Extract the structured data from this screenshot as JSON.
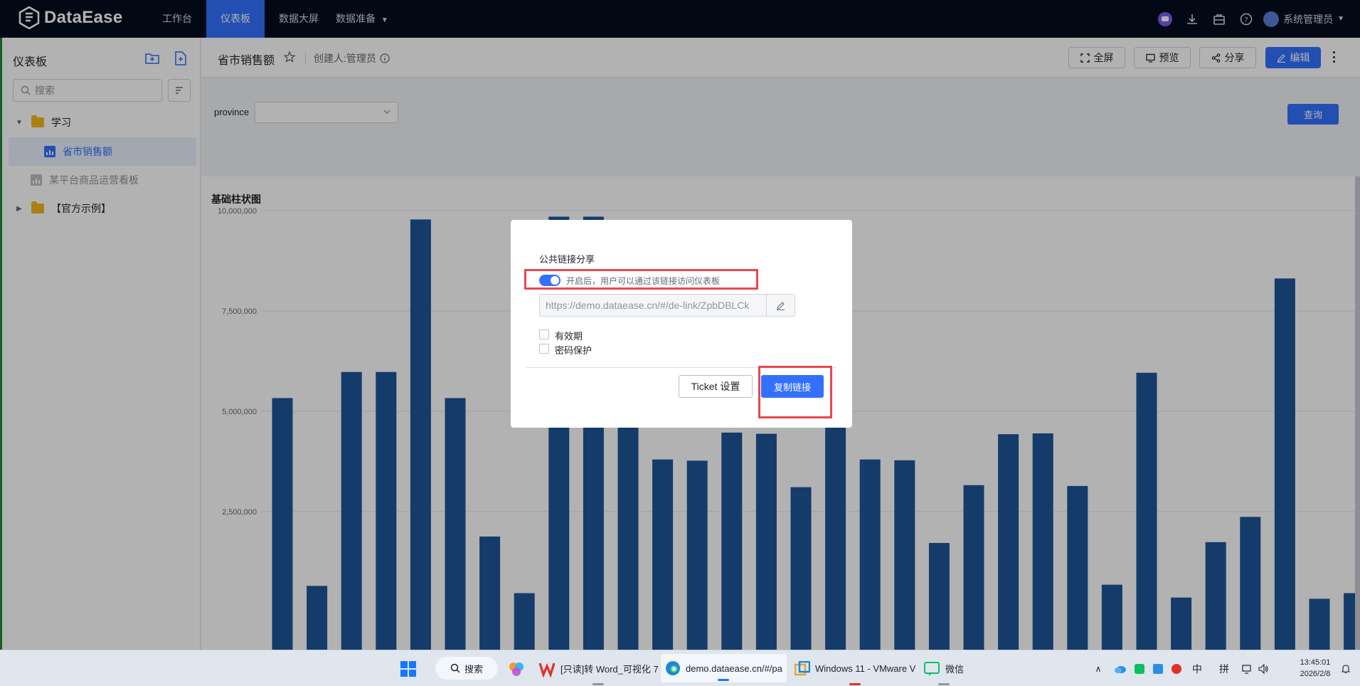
{
  "app": {
    "logo_text": "DataEase",
    "nav": [
      "工作台",
      "仪表板",
      "数据大屏",
      "数据准备"
    ],
    "user_name": "系统管理员"
  },
  "sidebar": {
    "title": "仪表板",
    "search_placeholder": "搜索",
    "tree": [
      {
        "label": "学习",
        "type": "folder"
      },
      {
        "label": "省市销售额",
        "type": "dashboard",
        "selected": true
      },
      {
        "label": "某平台商品运营看板",
        "type": "dashboard"
      },
      {
        "label": "【官方示例】",
        "type": "folder"
      }
    ]
  },
  "header": {
    "title": "省市销售额",
    "creator": "创建人:管理员",
    "buttons": {
      "fullscreen": "全屏",
      "preview": "预览",
      "share": "分享",
      "edit": "编辑"
    }
  },
  "filter": {
    "label": "province",
    "value": "",
    "query_button": "查询"
  },
  "chart_data": {
    "type": "bar",
    "title": "基础柱状图",
    "ylim": [
      0,
      10000000
    ],
    "y_ticks": [
      "10,000,000",
      "7,500,000",
      "5,000,000",
      "2,500,000"
    ],
    "categories": [],
    "values": [
      5330000,
      650000,
      5980000,
      5980000,
      9780000,
      5330000,
      1880000,
      470000,
      9850000,
      9850000,
      4790000,
      3800000,
      3770000,
      4470000,
      4440000,
      3110000,
      9180000,
      3800000,
      3780000,
      1720000,
      3160000,
      4430000,
      4450000,
      3140000,
      680000,
      5960000,
      360000,
      1740000,
      2370000,
      8310000,
      330000,
      470000,
      470000
    ],
    "color": "#1e5598",
    "grid": true,
    "legend": "none"
  },
  "modal": {
    "title": "公共链接分享",
    "toggle_on": true,
    "toggle_text": "开启后，用户可以通过该链接访问仪表板",
    "link_url": "https://demo.dataease.cn/#/de-link/ZpbDBLCk",
    "option_expiry": "有效期",
    "option_password": "密码保护",
    "ticket_button": "Ticket 设置",
    "copy_button": "复制链接"
  },
  "taskbar": {
    "search_label": "搜索",
    "apps": [
      {
        "label": "[只读]转 Word_可视化 7"
      },
      {
        "label": "demo.dataease.cn/#/pa"
      },
      {
        "label": "Windows 11 - VMware V"
      },
      {
        "label": "微信"
      }
    ],
    "ime_lang": "中",
    "ime_mode": "拼",
    "time": "13:45:01",
    "date": "2026/2/8"
  },
  "colors": {
    "accent": "#3370ff",
    "nav_bg": "#050e1e",
    "bar": "#1e5598",
    "highlight": "#e8474f"
  }
}
